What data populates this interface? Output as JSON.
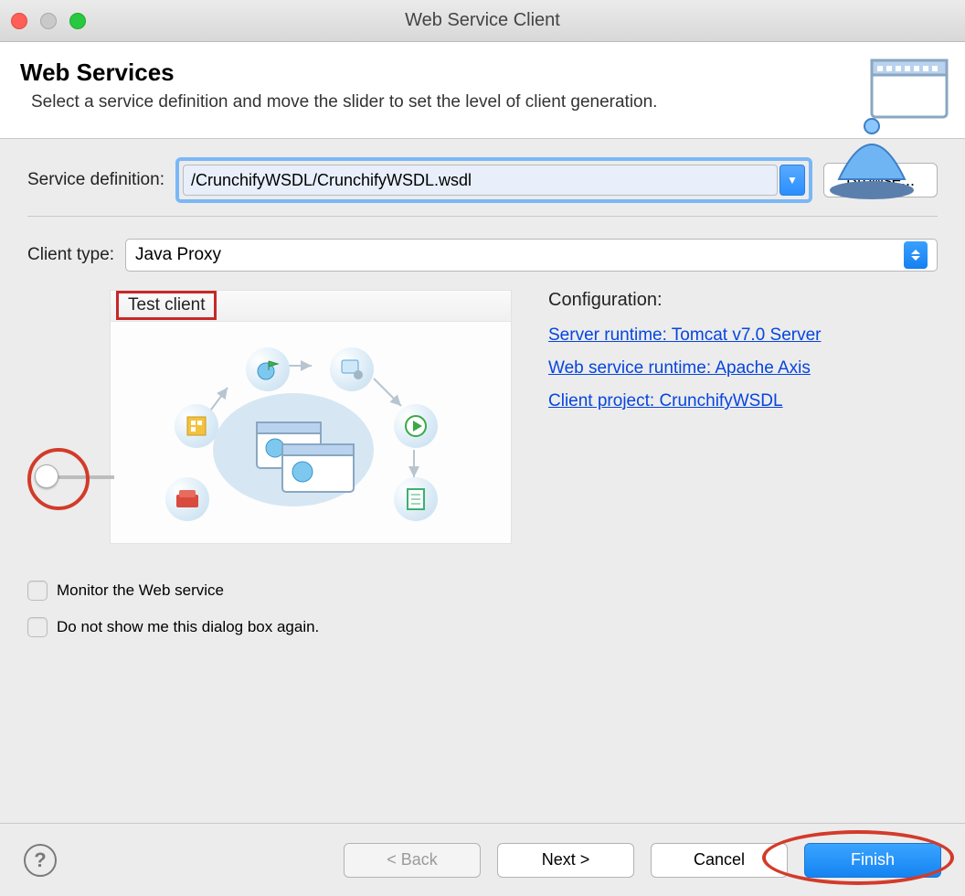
{
  "window": {
    "title": "Web Service Client"
  },
  "header": {
    "heading": "Web Services",
    "subtext": "Select a service definition and move the slider to set the level of client generation."
  },
  "serviceDefinition": {
    "label": "Service definition:",
    "value": "/CrunchifyWSDL/CrunchifyWSDL.wsdl",
    "browse": "Browse..."
  },
  "clientType": {
    "label": "Client type:",
    "value": "Java Proxy"
  },
  "testClientLabel": "Test client",
  "configuration": {
    "heading": "Configuration:",
    "serverRuntime": "Server runtime: Tomcat v7.0 Server",
    "wsRuntime": "Web service runtime: Apache Axis",
    "clientProject": "Client project: CrunchifyWSDL"
  },
  "checkboxes": {
    "monitor": "Monitor the Web service",
    "noShow": "Do not show me this dialog box again."
  },
  "buttons": {
    "back": "< Back",
    "next": "Next >",
    "cancel": "Cancel",
    "finish": "Finish"
  }
}
